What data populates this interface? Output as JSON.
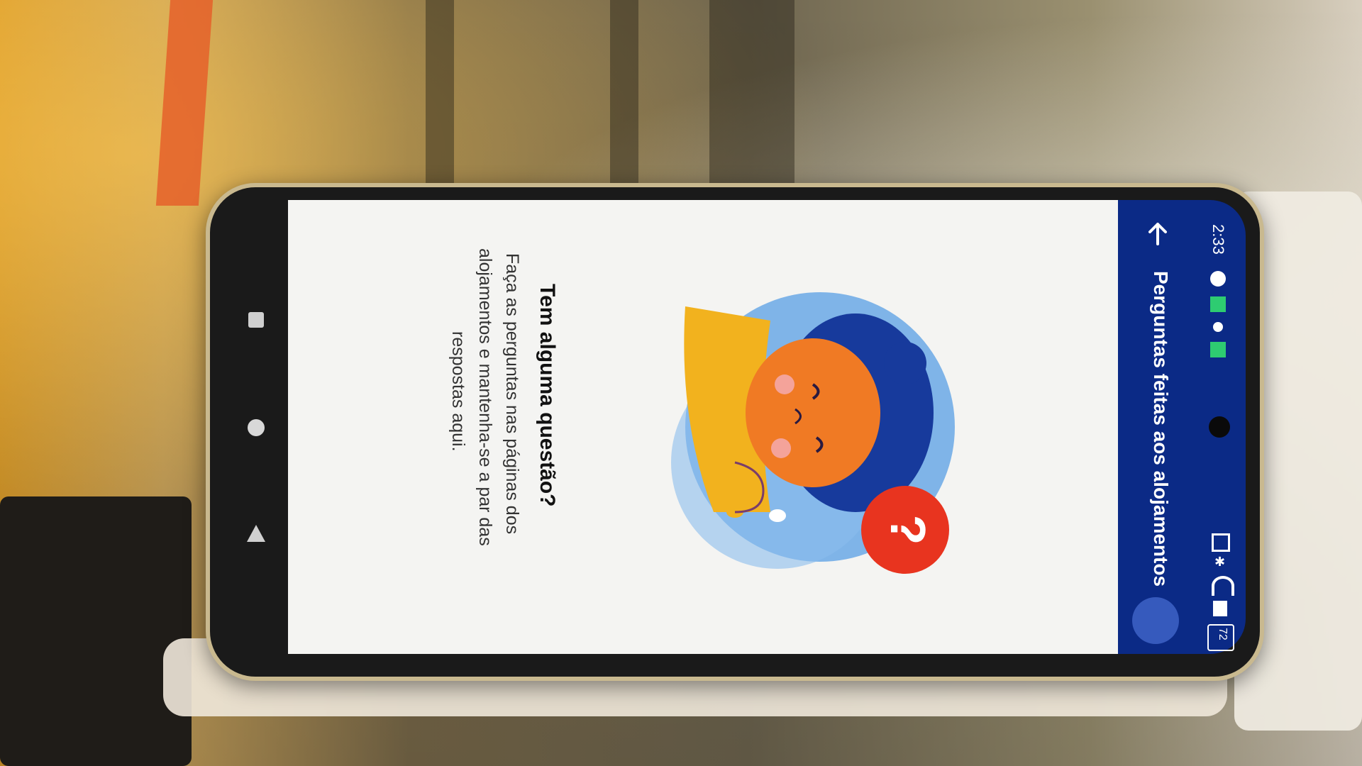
{
  "status_bar": {
    "time": "2:33",
    "battery": "72"
  },
  "app_bar": {
    "back_icon": "arrow-left-icon",
    "title": "Perguntas feitas aos alojamentos"
  },
  "empty_state": {
    "heading": "Tem alguma questão?",
    "body_line1": "Faça as perguntas nas páginas dos",
    "body_line2": "alojamentos e mantenha-se a par das",
    "body_line3": "respostas aqui."
  },
  "colors": {
    "app_bar": "#0b2a86",
    "screen_bg": "#f4f4f2",
    "accent_red": "#e8341f",
    "accent_orange": "#f07a24",
    "accent_blue": "#6aa8e6",
    "accent_yellow": "#f2b21e"
  }
}
